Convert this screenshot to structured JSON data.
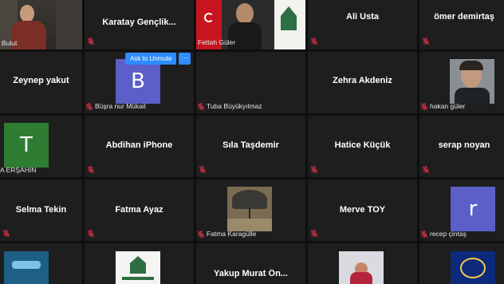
{
  "participants": {
    "bulut": {
      "name": "Bulut"
    },
    "karatay": {
      "name": "Karatay  Gençlik..."
    },
    "fettah": {
      "name": "Fettah Güler"
    },
    "ali": {
      "name": "Ali Usta"
    },
    "omer": {
      "name": "ömer demirtaş"
    },
    "zeynep": {
      "name": "Zeynep yakut"
    },
    "busra": {
      "name": "Büşra nur Mükail",
      "initial": "B"
    },
    "tuba": {
      "name": "Tuba Büyükyılmaz"
    },
    "zehra": {
      "name": "Zehra Akdeniz"
    },
    "hakan": {
      "name": "hakan güler"
    },
    "ersahin": {
      "name": "A ERŞAHİN",
      "initial": "T"
    },
    "abdihan": {
      "name": "Abdihan iPhone"
    },
    "sila": {
      "name": "Sıla Taşdemir"
    },
    "hatice": {
      "name": "Hatice Küçük"
    },
    "serap": {
      "name": "serap noyan"
    },
    "selma": {
      "name": "Selma Tekin"
    },
    "fatma_ayaz": {
      "name": "Fatma Ayaz"
    },
    "fatma_k": {
      "name": "Fatma Karagülle"
    },
    "merve": {
      "name": "Merve TOY"
    },
    "recep": {
      "name": "recep çintaş",
      "initial": "r"
    },
    "yakup": {
      "name": "Yakup  Murat  Ön..."
    }
  },
  "hover_menu": {
    "unmute_label": "Ask to Unmute",
    "more_label": "···"
  },
  "colors": {
    "tile": "#1e1e1e",
    "active_border": "#d9d46a",
    "mute_red": "#e8334a",
    "busra_avatar": "#5b5fc7",
    "ersahin_avatar": "#2e7d32",
    "recep_avatar": "#5b5fc7",
    "button_blue": "#2d8cff"
  }
}
